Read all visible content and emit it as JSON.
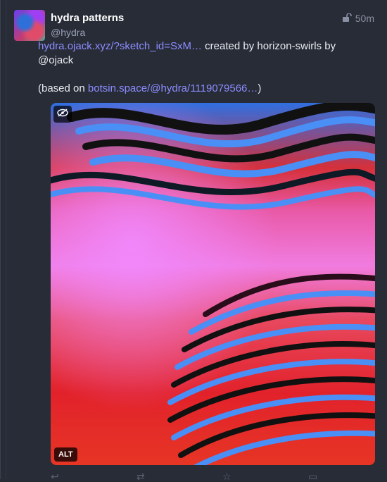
{
  "post": {
    "display_name": "hydra patterns",
    "handle": "@hydra",
    "time": "50m",
    "link_text": "hydra.ojack.xyz/?sketch_id=SxM…",
    "text_after_link": " created by horizon-swirls by @ojack",
    "based_prefix": "(based on ",
    "based_link": "botsin.space/@hydra/1119079566…",
    "based_suffix": ")"
  },
  "media": {
    "alt_label": "ALT"
  },
  "icons": {
    "visibility": "unlock-icon",
    "hide_media": "eye-slash-icon"
  },
  "colors": {
    "link": "#8c8dff",
    "background": "#282c37"
  }
}
